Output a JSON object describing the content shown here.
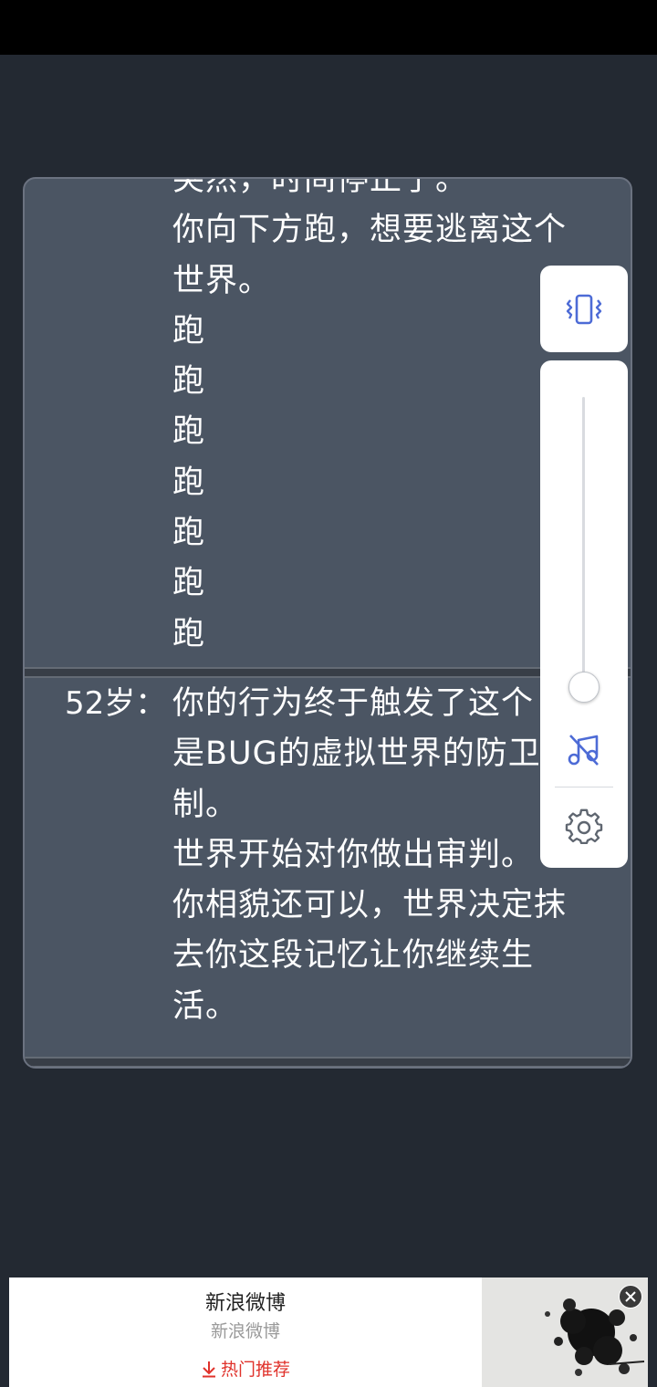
{
  "log": {
    "previous_entry": {
      "age": "",
      "lines": [
        "突然，时间停止了。",
        "你向下方跑，想要逃离这个",
        "世界。",
        "跑",
        "跑",
        "跑",
        "跑",
        "跑",
        "跑",
        "跑"
      ]
    },
    "entry_52": {
      "age": "52岁：",
      "lines": [
        "你的行为终于触发了这个",
        "是BUG的虚拟世界的防卫",
        "制。",
        "世界开始对你做出审判。",
        "你相貌还可以，世界决定抹",
        "去你这段记忆让你继续生",
        "活。"
      ]
    }
  },
  "controls": {
    "vibrate_icon": "vibrate-icon",
    "music_off_icon": "music-off-icon",
    "settings_icon": "gear-icon",
    "accent_color": "#4d6bd6"
  },
  "ad": {
    "title": "新浪微博",
    "subtitle": "新浪微博",
    "cta_label": "热门推荐",
    "cta_color": "#e0322b"
  }
}
